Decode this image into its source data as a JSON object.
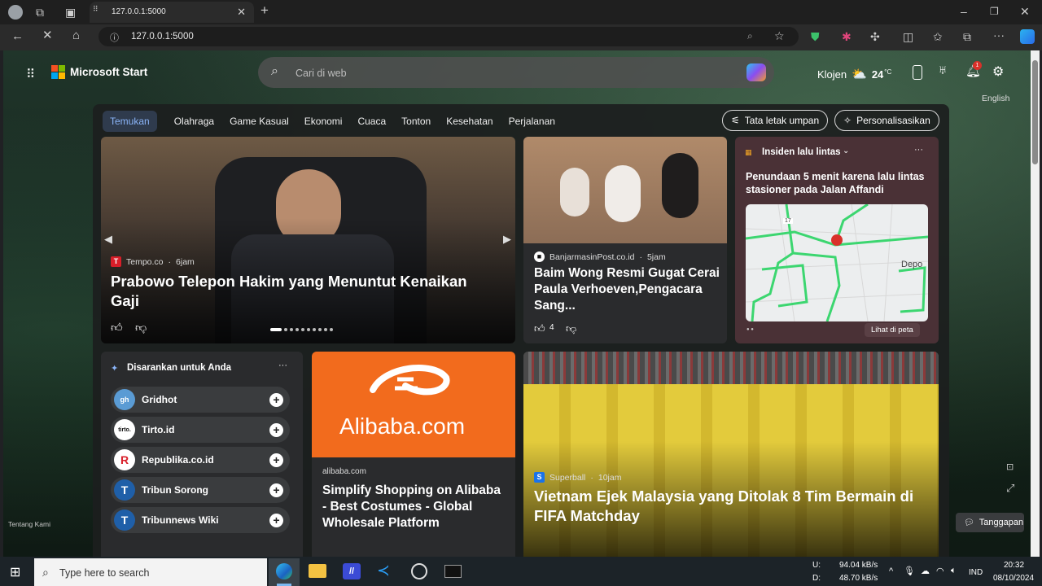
{
  "browser": {
    "tab_title": "127.0.0.1:5000",
    "url": "127.0.0.1:5000"
  },
  "header": {
    "brand": "Microsoft Start",
    "search_placeholder": "Cari di web",
    "location": "Klojen",
    "temperature": "24",
    "temp_unit": "°C",
    "notification_count": "1",
    "language": "English"
  },
  "nav": {
    "tabs": [
      "Temukan",
      "Olahraga",
      "Game Kasual",
      "Ekonomi",
      "Cuaca",
      "Tonton",
      "Kesehatan",
      "Perjalanan"
    ],
    "layout_button": "Tata letak umpan",
    "personalize_button": "Personalisasikan"
  },
  "hero": {
    "source": "Tempo.co",
    "time": "6jam",
    "headline": "Prabowo Telepon Hakim yang Menuntut Kenaikan Gaji"
  },
  "card2": {
    "source": "BanjarmasinPost.co.id",
    "time": "5jam",
    "headline": "Baim Wong Resmi Gugat Cerai Paula Verhoeven,Pengacara Sang...",
    "likes": "4"
  },
  "traffic": {
    "title": "Insiden lalu lintas",
    "headline": "Penundaan 5 menit karena lalu lintas stasioner pada Jalan Affandi",
    "map_label": "Depo",
    "road_number": "17",
    "link": "Lihat di peta"
  },
  "suggested": {
    "title": "Disarankan untuk Anda",
    "items": [
      {
        "name": "Gridhot",
        "logo": "gh"
      },
      {
        "name": "Tirto.id",
        "logo": "tirto."
      },
      {
        "name": "Republika.co.id",
        "logo": "R"
      },
      {
        "name": "Tribun Sorong",
        "logo": "T"
      },
      {
        "name": "Tribunnews Wiki",
        "logo": "T"
      }
    ]
  },
  "ad": {
    "brand_text": "Alibaba.com",
    "source": "alibaba.com",
    "headline": "Simplify Shopping on Alibaba - Best Costumes - Global Wholesale Platform"
  },
  "sports": {
    "source": "Superball",
    "time": "10jam",
    "headline": "Vietnam Ejek Malaysia yang Ditolak 8 Tim Bermain di FIFA Matchday"
  },
  "footer": {
    "about": "Tentang Kami",
    "feedback": "Tanggapan"
  },
  "taskbar": {
    "search_placeholder": "Type here to search",
    "upload_label": "U:",
    "upload_speed": "94.04 kB/s",
    "download_label": "D:",
    "download_speed": "48.70 kB/s",
    "language": "IND",
    "time": "20:32",
    "date": "08/10/2024"
  }
}
